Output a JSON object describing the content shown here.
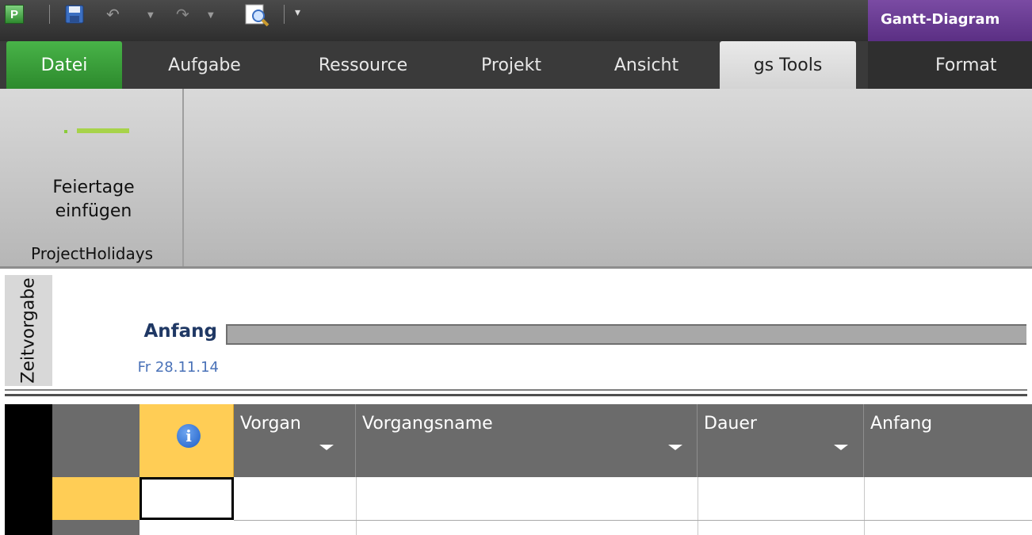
{
  "window": {
    "app_icon_letter": "P",
    "context_tab_title": "Gantt-Diagram"
  },
  "tabs": {
    "file": "Datei",
    "aufgabe": "Aufgabe",
    "ressource": "Ressource",
    "projekt": "Projekt",
    "ansicht": "Ansicht",
    "gstools": "gs Tools",
    "format": "Format"
  },
  "ribbon": {
    "button_line1": "Feiertage",
    "button_line2": "einfügen",
    "group_name": "ProjectHolidays"
  },
  "timeline": {
    "side_label": "Zeitvorgabe",
    "start_label": "Anfang",
    "start_date": "Fr 28.11.14"
  },
  "grid": {
    "columns": {
      "info_icon_glyph": "i",
      "vorgangsmodus": "Vorgan",
      "vorgangsname": "Vorgangsname",
      "dauer": "Dauer",
      "anfang": "Anfang"
    }
  },
  "colors": {
    "file_tab": "#2d8a2d",
    "context_tab": "#5b2f84",
    "selected_header": "#ffcd55",
    "timeline_label": "#1f3864"
  }
}
